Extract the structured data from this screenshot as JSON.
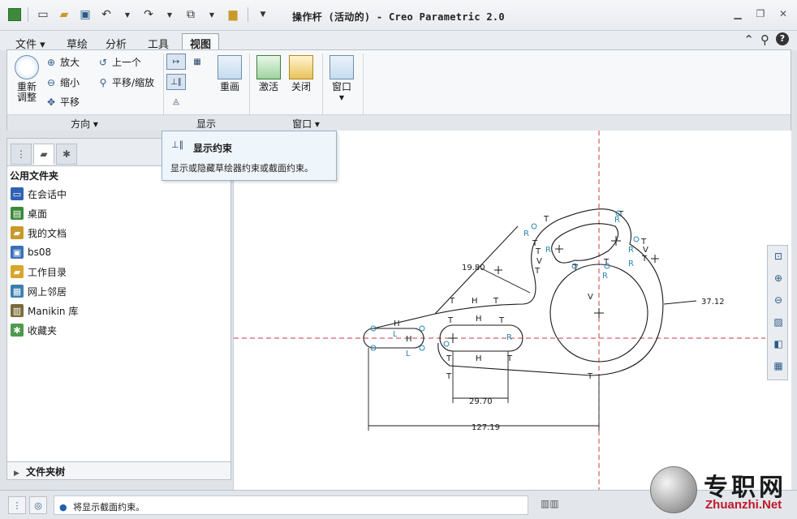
{
  "title_bar": {
    "app_title": "操作杆 (活动的) - Creo Parametric 2.0"
  },
  "tabs": [
    {
      "label": "文件",
      "active": false
    },
    {
      "label": "草绘",
      "active": false
    },
    {
      "label": "分析",
      "active": false
    },
    {
      "label": "工具",
      "active": false
    },
    {
      "label": "视图",
      "active": true
    }
  ],
  "ribbon": {
    "orientation": {
      "label": "方向",
      "refit_label": "重新\n调整",
      "zoom_in": "放大",
      "zoom_out": "缩小",
      "pan": "平移",
      "previous": "上一个",
      "pan_zoom": "平移/缩放"
    },
    "display": {
      "label": "显示",
      "repaint": "重画"
    },
    "window": {
      "label": "窗口",
      "activate": "激活",
      "close": "关闭",
      "window": "窗口"
    }
  },
  "tooltip": {
    "title": "显示约束",
    "description": "显示或隐藏草绘器约束或截面约束。"
  },
  "left_panel": {
    "header": "公用文件夹",
    "items": [
      {
        "label": "在会话中",
        "icon": "monitor-icon",
        "color": "#2f62b3"
      },
      {
        "label": "桌面",
        "icon": "desktop-icon",
        "color": "#3b8a3b"
      },
      {
        "label": "我的文档",
        "icon": "documents-icon",
        "color": "#c99a2a"
      },
      {
        "label": "bs08",
        "icon": "computer-icon",
        "color": "#3a6fb7"
      },
      {
        "label": "工作目录",
        "icon": "working-folder-icon",
        "color": "#d9a62a"
      },
      {
        "label": "网上邻居",
        "icon": "network-icon",
        "color": "#3b7fb0"
      },
      {
        "label": "Manikin 库",
        "icon": "library-icon",
        "color": "#7a6a3a"
      },
      {
        "label": "收藏夹",
        "icon": "favorites-icon",
        "color": "#4f9a4f"
      }
    ],
    "folder_tree": "文件夹树"
  },
  "sketch": {
    "dim_radius": "19.80",
    "dim_diameter": "37.12",
    "dim_slot": "29.70",
    "dim_overall": "127.19",
    "constraint_letters": [
      "T",
      "H",
      "V",
      "R",
      "L"
    ]
  },
  "status_bar": {
    "message": "将显示截面约束。"
  },
  "watermark": {
    "brand_cn": "专职网",
    "brand_en": "Zhuanzhi.Net"
  },
  "colors": {
    "axis_red": "#c43c3c",
    "constraint_blue": "#2b86b0",
    "accent": "#2c5a86"
  }
}
